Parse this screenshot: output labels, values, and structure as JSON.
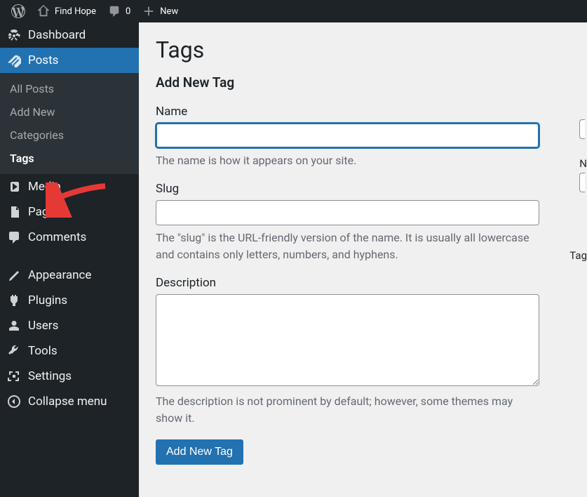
{
  "topbar": {
    "site_name": "Find Hope",
    "comments_count": "0",
    "new_label": "New"
  },
  "sidebar": {
    "dashboard": "Dashboard",
    "posts": "Posts",
    "posts_sub": {
      "all_posts": "All Posts",
      "add_new": "Add New",
      "categories": "Categories",
      "tags": "Tags"
    },
    "media": "Media",
    "pages": "Pages",
    "comments": "Comments",
    "appearance": "Appearance",
    "plugins": "Plugins",
    "users": "Users",
    "tools": "Tools",
    "settings": "Settings",
    "collapse": "Collapse menu"
  },
  "main": {
    "page_title": "Tags",
    "form_heading": "Add New Tag",
    "name_label": "Name",
    "name_help": "The name is how it appears on your site.",
    "slug_label": "Slug",
    "slug_help": "The \"slug\" is the URL-friendly version of the name. It is usually all lowercase and contains only letters, numbers, and hyphens.",
    "description_label": "Description",
    "description_help": "The description is not prominent by default; however, some themes may show it.",
    "submit_label": "Add New Tag"
  },
  "right_panel": {
    "n_label": "N",
    "tag_label": "Tag"
  }
}
